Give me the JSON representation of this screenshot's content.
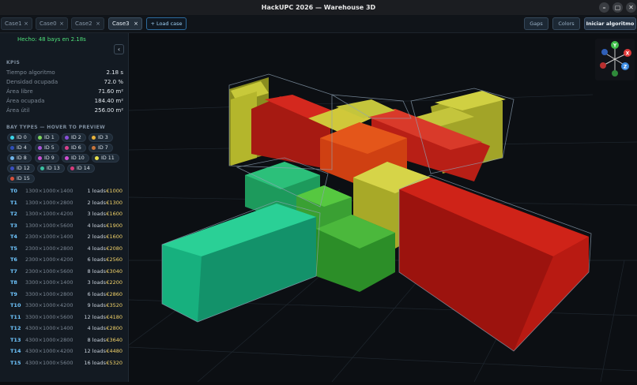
{
  "window": {
    "title": "HackUPC 2026 — Warehouse 3D",
    "min_glyph": "–",
    "max_glyph": "▢",
    "close_glyph": "✕"
  },
  "tabs": [
    {
      "label": "Case1",
      "close": "×"
    },
    {
      "label": "Case0",
      "close": "×"
    },
    {
      "label": "Case2",
      "close": "×"
    },
    {
      "label": "Case3",
      "close": "×"
    }
  ],
  "toolbar": {
    "load_case": "+ Load case",
    "gaps": "Gaps",
    "colors": "Colors",
    "run": "Iniciar algoritmo"
  },
  "panel": {
    "status": "Hecho: 48 bays en 2.18s",
    "collapse_glyph": "‹",
    "kpis_title": "KPIS",
    "kpis": [
      {
        "label": "Tiempo algoritmo",
        "value": "2.18 s"
      },
      {
        "label": "Densidad ocupada",
        "value": "72.0 %"
      },
      {
        "label": "Área libre",
        "value": "71.60 m²"
      },
      {
        "label": "Área ocupada",
        "value": "184.40 m²"
      },
      {
        "label": "Área útil",
        "value": "256.00 m²"
      }
    ],
    "bay_types_title": "BAY TYPES — HOVER TO PREVIEW",
    "bay_ids": [
      {
        "label": "ID 0",
        "color": "#3bd4e8"
      },
      {
        "label": "ID 1",
        "color": "#7dd35c"
      },
      {
        "label": "ID 2",
        "color": "#8a4fd8"
      },
      {
        "label": "ID 3",
        "color": "#e8b13a"
      },
      {
        "label": "ID 4",
        "color": "#2f4fb8"
      },
      {
        "label": "ID 5",
        "color": "#a855d8"
      },
      {
        "label": "ID 6",
        "color": "#d8418c"
      },
      {
        "label": "ID 7",
        "color": "#c8743a"
      },
      {
        "label": "ID 8",
        "color": "#6fb3e8"
      },
      {
        "label": "ID 9",
        "color": "#c84fd0"
      },
      {
        "label": "ID 10",
        "color": "#d04fd0"
      },
      {
        "label": "ID 11",
        "color": "#e8e04a"
      },
      {
        "label": "ID 12",
        "color": "#3a4fc0"
      },
      {
        "label": "ID 13",
        "color": "#3ac0a0"
      },
      {
        "label": "ID 14",
        "color": "#d83a7a"
      },
      {
        "label": "ID 15",
        "color": "#d8503a"
      }
    ],
    "bay_types": [
      {
        "id": "T0",
        "dims": "1300×1000×1400",
        "loads": "1 loads",
        "price": "€1000"
      },
      {
        "id": "T1",
        "dims": "1300×1000×2800",
        "loads": "2 loads",
        "price": "€1300"
      },
      {
        "id": "T2",
        "dims": "1300×1000×4200",
        "loads": "3 loads",
        "price": "€1600"
      },
      {
        "id": "T3",
        "dims": "1300×1000×5600",
        "loads": "4 loads",
        "price": "€1900"
      },
      {
        "id": "T4",
        "dims": "2300×1000×1400",
        "loads": "2 loads",
        "price": "€1600"
      },
      {
        "id": "T5",
        "dims": "2300×1000×2800",
        "loads": "4 loads",
        "price": "€2080"
      },
      {
        "id": "T6",
        "dims": "2300×1000×4200",
        "loads": "6 loads",
        "price": "€2560"
      },
      {
        "id": "T7",
        "dims": "2300×1000×5600",
        "loads": "8 loads",
        "price": "€3040"
      },
      {
        "id": "T8",
        "dims": "3300×1000×1400",
        "loads": "3 loads",
        "price": "€2200"
      },
      {
        "id": "T9",
        "dims": "3300×1000×2800",
        "loads": "6 loads",
        "price": "€2860"
      },
      {
        "id": "T10",
        "dims": "3300×1000×4200",
        "loads": "9 loads",
        "price": "€3520"
      },
      {
        "id": "T11",
        "dims": "3300×1000×5600",
        "loads": "12 loads",
        "price": "€4180"
      },
      {
        "id": "T12",
        "dims": "4300×1000×1400",
        "loads": "4 loads",
        "price": "€2800"
      },
      {
        "id": "T13",
        "dims": "4300×1000×2800",
        "loads": "8 loads",
        "price": "€3640"
      },
      {
        "id": "T14",
        "dims": "4300×1000×4200",
        "loads": "12 loads",
        "price": "€4480"
      },
      {
        "id": "T15",
        "dims": "4300×1000×5600",
        "loads": "16 loads",
        "price": "€5320"
      }
    ]
  },
  "gizmo": {
    "y": "Y",
    "x": "X",
    "z": "Z"
  }
}
